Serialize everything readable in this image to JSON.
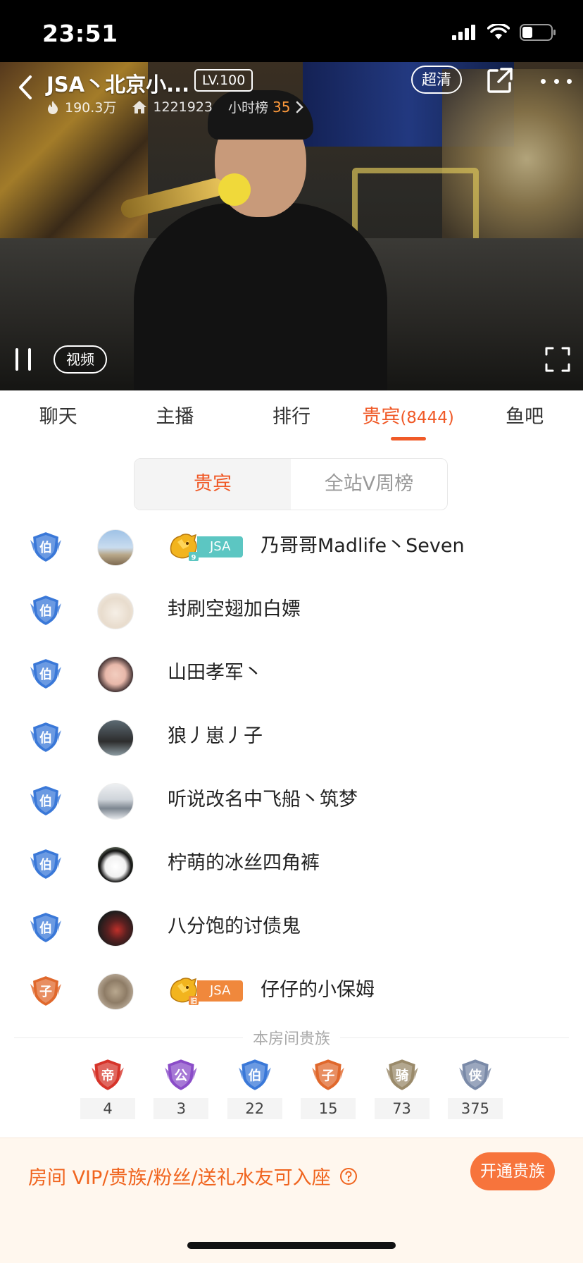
{
  "status_bar": {
    "time": "23:51"
  },
  "header": {
    "room_title": "JSA丶北京小...",
    "level": "LV.100",
    "quality": "超清",
    "heat": "190.3万",
    "room_id": "1221923",
    "rank_label": "小时榜",
    "rank_value": "35"
  },
  "video": {
    "mode_label": "视频"
  },
  "tabs": [
    {
      "label": "聊天"
    },
    {
      "label": "主播"
    },
    {
      "label": "排行"
    },
    {
      "label": "贵宾",
      "count": "(8444)"
    },
    {
      "label": "鱼吧"
    }
  ],
  "segment": {
    "left": "贵宾",
    "right": "全站V周榜"
  },
  "guests": [
    {
      "name": "乃哥哥Madlife丶Seven",
      "rank": "伯",
      "fan_tag": "JSA",
      "fan_level": "9",
      "fan_color": "#5cc6c2",
      "avatar": "beach"
    },
    {
      "name": "封刷空翅加白嫖",
      "rank": "伯",
      "avatar": "cat-white"
    },
    {
      "name": "山田孝军丶",
      "rank": "伯",
      "avatar": "girl"
    },
    {
      "name": "狼丿崽丿子",
      "rank": "伯",
      "avatar": "person-dark"
    },
    {
      "name": "听说改名中飞船丶筑梦",
      "rank": "伯",
      "avatar": "car"
    },
    {
      "name": "柠萌的冰丝四角裤",
      "rank": "伯",
      "avatar": "panda"
    },
    {
      "name": "八分饱的讨债鬼",
      "rank": "伯",
      "avatar": "motorbike"
    },
    {
      "name": "仔仔的小保姆",
      "rank": "子",
      "fan_tag": "JSA",
      "fan_level": "旧",
      "fan_color": "#f0883c",
      "avatar": "cat-grey"
    }
  ],
  "nobility": {
    "title": "本房间贵族",
    "items": [
      {
        "rank": "帝",
        "count": "4",
        "color": "#d6342a"
      },
      {
        "rank": "公",
        "count": "3",
        "color": "#8a4cc8"
      },
      {
        "rank": "伯",
        "count": "22",
        "color": "#3a78d8"
      },
      {
        "rank": "子",
        "count": "15",
        "color": "#e0682c"
      },
      {
        "rank": "骑",
        "count": "73",
        "color": "#9a8a6a"
      },
      {
        "rank": "侠",
        "count": "375",
        "color": "#7a8aa8"
      }
    ]
  },
  "bottom": {
    "notice": "房间 VIP/贵族/粉丝/送礼水友可入座",
    "open_button": "开通贵族"
  },
  "colors": {
    "accent": "#f05a28",
    "button": "#f7743c",
    "bottom_bg": "#fff7ee"
  }
}
